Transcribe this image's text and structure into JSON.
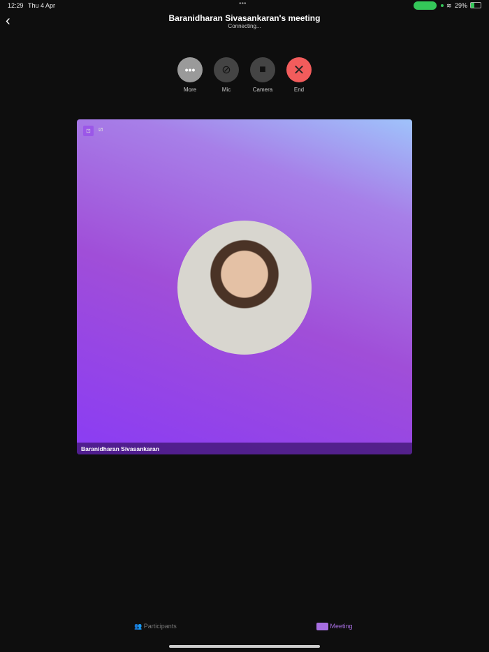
{
  "status": {
    "time": "12:29",
    "date": "Thu 4 Apr",
    "battery": "29%"
  },
  "header": {
    "title": "Baranidharan Sivasankaran's meeting",
    "subtitle": "Connecting..."
  },
  "controls": [
    {
      "label": "More"
    },
    {
      "label": "Mic"
    },
    {
      "label": "Camera"
    },
    {
      "label": "End"
    }
  ],
  "tile": {
    "name": "Baranidharan Sivasankaran"
  },
  "tabs": [
    {
      "label": "Participants"
    },
    {
      "label": "Meeting"
    }
  ],
  "colors": {
    "accent": "#a66ee0",
    "end": "#f25c5c",
    "status_green": "#34c759"
  }
}
